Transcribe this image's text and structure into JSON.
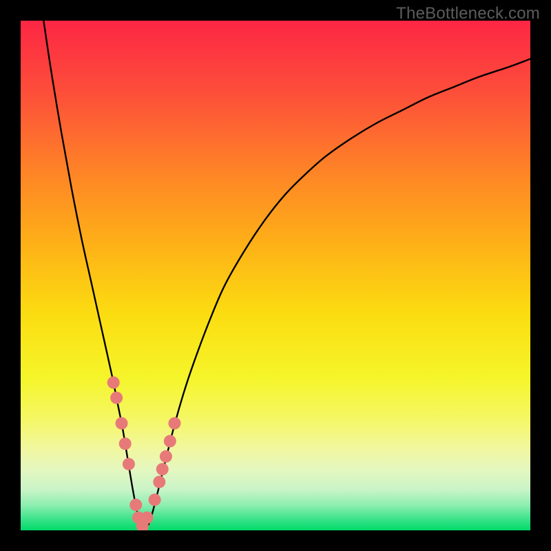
{
  "attribution": "TheBottleneck.com",
  "colors": {
    "frame": "#000000",
    "curve": "#000000",
    "marker_fill": "#e77a78",
    "marker_stroke": "#d96a68",
    "attribution_text": "#5c5c5c"
  },
  "gradient_stops": [
    {
      "pct": 0,
      "color": "#fd2644"
    },
    {
      "pct": 14,
      "color": "#fd4e3a"
    },
    {
      "pct": 30,
      "color": "#fe8526"
    },
    {
      "pct": 44,
      "color": "#feb117"
    },
    {
      "pct": 58,
      "color": "#fbde11"
    },
    {
      "pct": 70,
      "color": "#f5f52a"
    },
    {
      "pct": 78,
      "color": "#f5f763"
    },
    {
      "pct": 84,
      "color": "#f1f79f"
    },
    {
      "pct": 88,
      "color": "#e5f7bf"
    },
    {
      "pct": 92,
      "color": "#c9f4c7"
    },
    {
      "pct": 95,
      "color": "#8eeeb1"
    },
    {
      "pct": 98,
      "color": "#35e286"
    },
    {
      "pct": 100,
      "color": "#00da6a"
    }
  ],
  "chart_data": {
    "type": "line",
    "title": "",
    "xlabel": "",
    "ylabel": "",
    "xlim": [
      0,
      100
    ],
    "ylim": [
      0,
      100
    ],
    "grid": false,
    "legend": false,
    "series": [
      {
        "name": "curve",
        "color": "#000000",
        "x": [
          4.5,
          6,
          8,
          10,
          12,
          14,
          16,
          18,
          19,
          20,
          21,
          22,
          23,
          24,
          25,
          26,
          28,
          30,
          32,
          34,
          37,
          40,
          44,
          48,
          52,
          56,
          60,
          65,
          70,
          75,
          80,
          85,
          90,
          96,
          100
        ],
        "y": [
          100,
          90,
          78,
          67,
          57,
          48,
          39,
          30,
          25,
          20,
          14,
          8,
          3,
          0.5,
          1,
          4,
          12,
          20,
          27,
          33,
          41,
          48,
          55,
          61,
          66,
          70,
          73.5,
          77,
          80,
          82.5,
          85,
          87,
          89,
          91,
          92.5
        ]
      }
    ],
    "markers": {
      "name": "highlighted-points",
      "color": "#e77a78",
      "radius_px": 9,
      "x": [
        18.2,
        18.8,
        19.8,
        20.5,
        21.2,
        22.6,
        23.1,
        23.9,
        24.8,
        26.3,
        27.2,
        27.8,
        28.5,
        29.3,
        30.2
      ],
      "y": [
        29,
        26,
        21,
        17,
        13,
        5,
        2.5,
        0.8,
        2.5,
        6,
        9.5,
        12,
        14.5,
        17.5,
        21
      ]
    }
  }
}
